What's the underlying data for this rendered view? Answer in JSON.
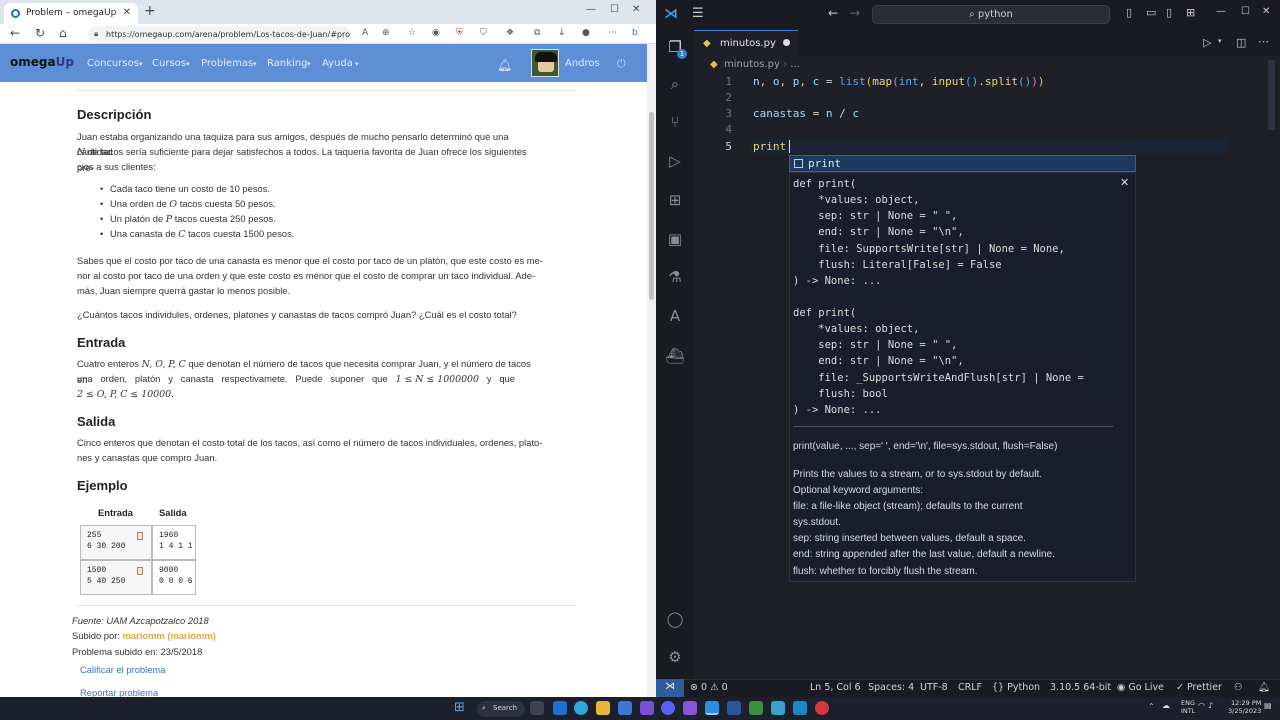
{
  "browser": {
    "tab_title": "Problem – omegaUp",
    "url": "https://omegaup.com/arena/problem/Los-tacos-de-Juan/#problems",
    "nav": {
      "logo_a": "omega",
      "logo_b": "Up",
      "items": [
        "Concursos",
        "Cursos",
        "Problemas",
        "Ranking",
        "Ayuda"
      ],
      "user": "Andros"
    },
    "problem": {
      "desc_title": "Descripción",
      "desc_p1": "Juan estaba organizando una taquiza para sus amigos, después de mucho pensarlo determinó que una cantidad",
      "desc_p1b": "N",
      "desc_p1c": " de tacos sería suficiente para dejar satisfechos a todos. La taquería favorita de Juan ofrece los siguientes pre-",
      "desc_p1d": "cios a sus clientes:",
      "bullets": [
        {
          "pre": "Cada taco tiene un costo de 10 pesos.",
          "var": "",
          "post": ""
        },
        {
          "pre": "Una orden de ",
          "var": "O",
          "post": " tacos cuesta 50 pesos."
        },
        {
          "pre": "Un platón de ",
          "var": "P",
          "post": " tacos cuesta 250 pesos."
        },
        {
          "pre": "Una canasta de ",
          "var": "C",
          "post": " tacos cuesta 1500 pesos."
        }
      ],
      "desc_p2": "Sabes que el costo por taco de una canasta es menor que el costo por taco de un platón, que este costo es me-",
      "desc_p2b": "nor al costo por taco de una orden y que este costo es menor que el costo de comprar un taco individual. Ade-",
      "desc_p2c": "más, Juan siempre querrá gastar lo menos posible.",
      "desc_q": "¿Cuántos tacos individules, ordenes, platones y canastas de tacos compró Juan? ¿Cuál es el costo total?",
      "input_title": "Entrada",
      "input_p1a": "Cuatro enteros ",
      "input_p1b": "N, O, P, C",
      "input_p1c": " que denotan el número de tacos que necesita comprar Juan, y el número de tacos en",
      "input_p2": "una   orden,   platón   y   canasta   respectivamete.   Puede   suponer   que",
      "input_p2b": "1 ≤ N ≤ 1000000",
      "input_p2c": "y   que",
      "input_p3": "2 ≤ O, P, C ≤ 10000.",
      "output_title": "Salida",
      "output_p1": "Cinco enteros que denotan el costo total de los tacos, así como el número de tacos individuales, ordenes, plato-",
      "output_p2": "nes y canastas que compro Juan.",
      "example_title": "Ejemplo",
      "example_head_in": "Entrada",
      "example_head_out": "Salida",
      "examples": [
        {
          "in": "255\n6 30 200",
          "out": "1960\n1 4 1 1"
        },
        {
          "in": "1500\n5 40 250",
          "out": "9000\n0 0 0 6"
        }
      ],
      "source": "Fuente: UAM Azcapotzalco 2018",
      "uploaded_by_label": "Subido por: ",
      "uploaded_by": "mariomm (mariomm)",
      "uploaded_on": "Problema subido en: 23/5/2018",
      "rate_link": "Calificar el problema",
      "report_link": "Reportar problema"
    }
  },
  "vscode": {
    "search": "python",
    "tab": "minutos.py",
    "breadcrumb": "minutos.py",
    "breadcrumb_more": "...",
    "line_numbers": [
      "1",
      "2",
      "3",
      "4",
      "5"
    ],
    "suggestion": "print",
    "hover_sig1": [
      "def print(",
      "    *values: object,",
      "    sep: str | None = \" \",",
      "    end: str | None = \"\\n\",",
      "    file: SupportsWrite[str] | None = None,",
      "    flush: Literal[False] = False",
      ") -> None: ..."
    ],
    "hover_sig2": [
      "def print(",
      "    *values: object,",
      "    sep: str | None = \" \",",
      "    end: str | None = \"\\n\",",
      "    file: _SupportsWriteAndFlush[str] | None =",
      "    flush: bool",
      ") -> None: ..."
    ],
    "hover_summary": "print(value, ..., sep=' ', end='\\n', file=sys.stdout, flush=False)",
    "hover_doc": [
      "Prints the values to a stream, or to sys.stdout by default.",
      "Optional keyword arguments:",
      "file: a file-like object (stream); defaults to the current",
      "sys.stdout.",
      "sep: string inserted between values, default a space.",
      "end: string appended after the last value, default a newline.",
      "flush: whether to forcibly flush the stream."
    ],
    "explorer_badge": "1",
    "status": {
      "errors": "0",
      "warnings": "0",
      "position": "Ln 5, Col 6",
      "spaces": "Spaces: 4",
      "encoding": "UTF-8",
      "eol": "CRLF",
      "language": "Python",
      "interpreter": "3.10.5 64-bit",
      "golive": "Go Live",
      "prettier": "Prettier"
    }
  },
  "taskbar": {
    "search": "Search",
    "lang": "ENG",
    "lang2": "INTL",
    "time": "12:29 PM",
    "date": "3/25/2023"
  }
}
